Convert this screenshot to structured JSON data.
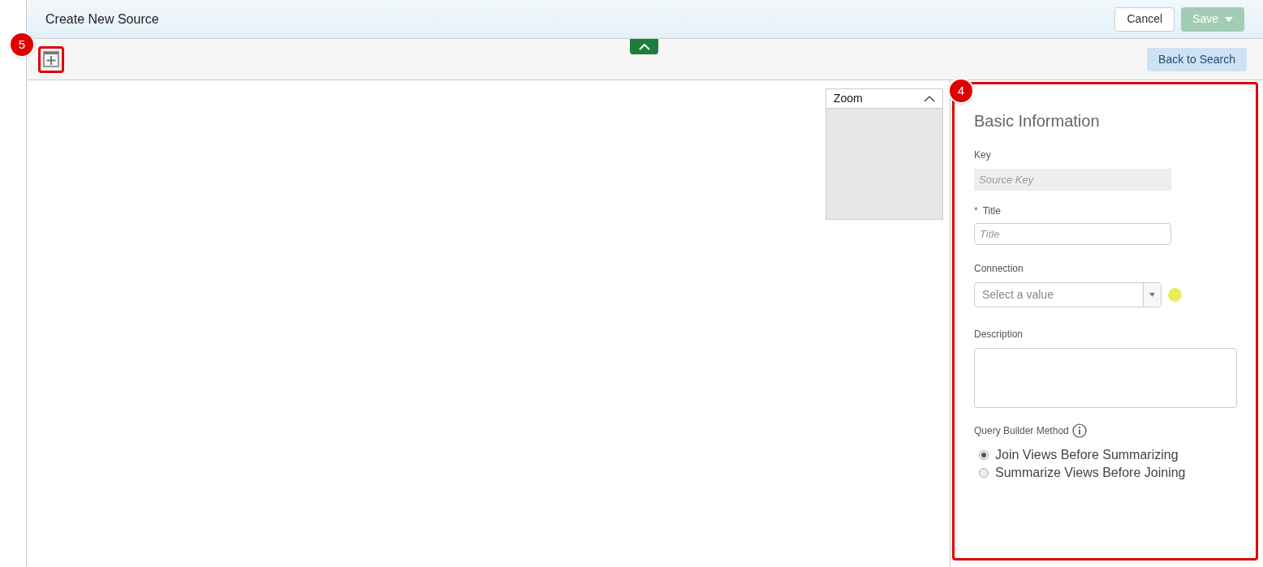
{
  "header": {
    "title": "Create New Source",
    "cancel": "Cancel",
    "save": {
      "label": "Save",
      "disabled": true
    }
  },
  "toolbar": {
    "back": "Back to Search"
  },
  "callouts": [
    {
      "number": "5"
    },
    {
      "number": "4"
    }
  ],
  "zoom_panel": {
    "title": "Zoom",
    "expanded": true
  },
  "form": {
    "heading": "Basic Information",
    "key": {
      "label": "Key",
      "placeholder": "Source Key",
      "disabled": true
    },
    "title": {
      "label": "Title",
      "placeholder": "Title",
      "required_marker": "*"
    },
    "connection": {
      "label": "Connection",
      "placeholder": "Select a value"
    },
    "description": {
      "label": "Description"
    },
    "method": {
      "label": "Query Builder Method",
      "options": [
        {
          "label": "Join Views Before Summarizing",
          "selected": true
        },
        {
          "label": "Summarize Views Before Joining",
          "selected": false
        }
      ]
    }
  }
}
